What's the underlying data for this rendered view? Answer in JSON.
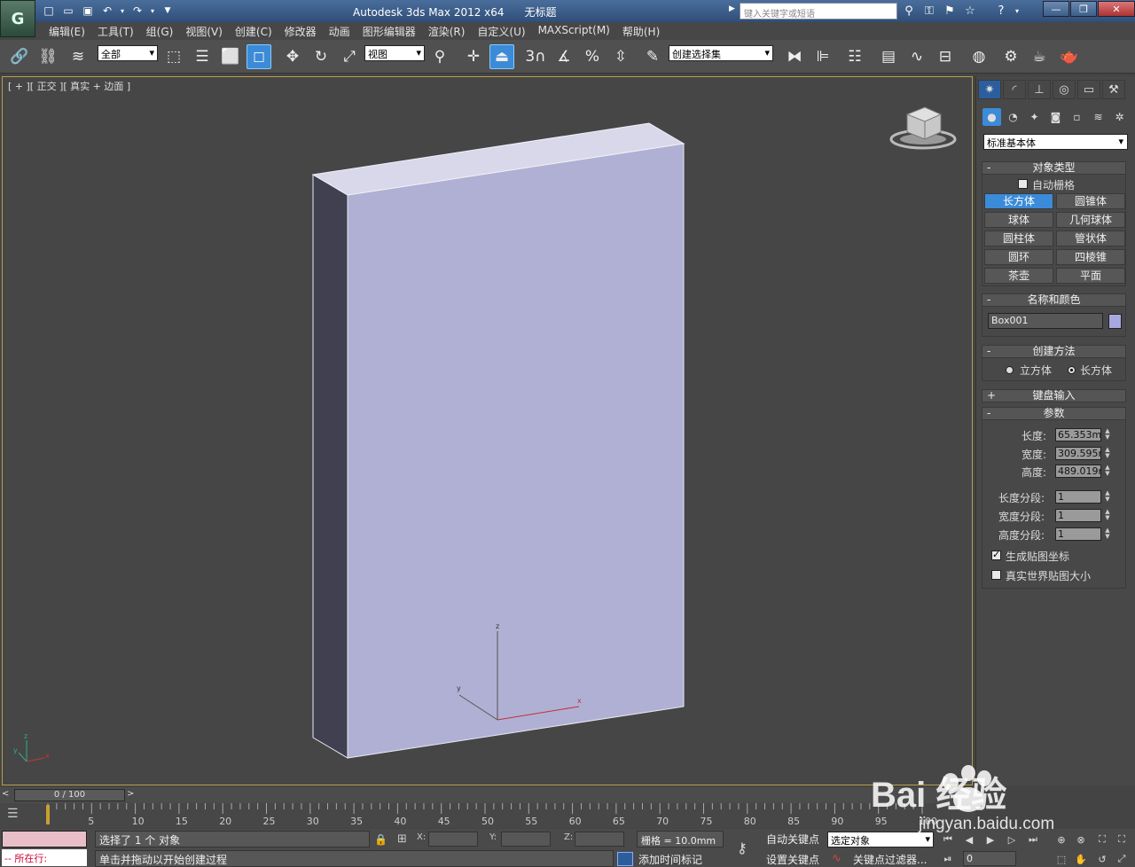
{
  "app": {
    "logo_letter": "G",
    "title": "Autodesk 3ds Max  2012 x64",
    "document": "无标题"
  },
  "search": {
    "placeholder": "键入关键字或短语"
  },
  "menu": [
    "编辑(E)",
    "工具(T)",
    "组(G)",
    "视图(V)",
    "创建(C)",
    "修改器",
    "动画",
    "图形编辑器",
    "渲染(R)",
    "自定义(U)",
    "MAXScript(M)",
    "帮助(H)"
  ],
  "toolbar": {
    "selection_filter": "全部",
    "ref_coord": "视图",
    "named_selection": "创建选择集",
    "snap_num": "3",
    "percent_snap": "%"
  },
  "viewport": {
    "label": "[ + ][ 正交 ][ 真实 + 边面 ]",
    "axis_x": "x",
    "axis_y": "y",
    "axis_z": "z"
  },
  "panel": {
    "category": "标准基本体",
    "object_type": {
      "title": "对象类型",
      "autogrid": "自动栅格",
      "autogrid_checked": false,
      "buttons": [
        [
          "长方体",
          "圆锥体"
        ],
        [
          "球体",
          "几何球体"
        ],
        [
          "圆柱体",
          "管状体"
        ],
        [
          "圆环",
          "四棱锥"
        ],
        [
          "茶壶",
          "平面"
        ]
      ],
      "active": "长方体"
    },
    "name_color": {
      "title": "名称和颜色",
      "name": "Box001",
      "color": "#a8a8e0"
    },
    "creation": {
      "title": "创建方法",
      "cube": "立方体",
      "box": "长方体",
      "selected": "box"
    },
    "keyboard": {
      "title": "键盘输入"
    },
    "params": {
      "title": "参数",
      "length_label": "长度:",
      "length": "65.353mm",
      "width_label": "宽度:",
      "width": "309.595m",
      "height_label": "高度:",
      "height": "489.019m",
      "length_segs_label": "长度分段:",
      "length_segs": "1",
      "width_segs_label": "宽度分段:",
      "width_segs": "1",
      "height_segs_label": "高度分段:",
      "height_segs": "1",
      "gen_map": "生成贴图坐标",
      "gen_map_checked": true,
      "real_world": "真实世界贴图大小",
      "real_world_checked": false
    }
  },
  "timeline": {
    "frame": "0 / 100",
    "ticks": [
      "0",
      "5",
      "10",
      "15",
      "20",
      "25",
      "30",
      "35",
      "40",
      "45",
      "50",
      "55",
      "60",
      "65",
      "70",
      "75",
      "80",
      "85",
      "90",
      "95",
      "100"
    ]
  },
  "status": {
    "maxscript": "-- 所在行:",
    "selected": "选择了 1 个 对象",
    "prompt": "单击并拖动以开始创建过程",
    "x": "X:",
    "y": "Y:",
    "z": "Z:",
    "grid": "栅格 = 10.0mm",
    "add_time_tag": "添加时间标记",
    "auto_key": "自动关键点",
    "set_key": "设置关键点",
    "key_mode": "选定对象",
    "key_filters": "关键点过滤器...",
    "frame": "0"
  },
  "watermark": {
    "text": "Bai 经验",
    "url": "jingyan.baidu.com"
  }
}
